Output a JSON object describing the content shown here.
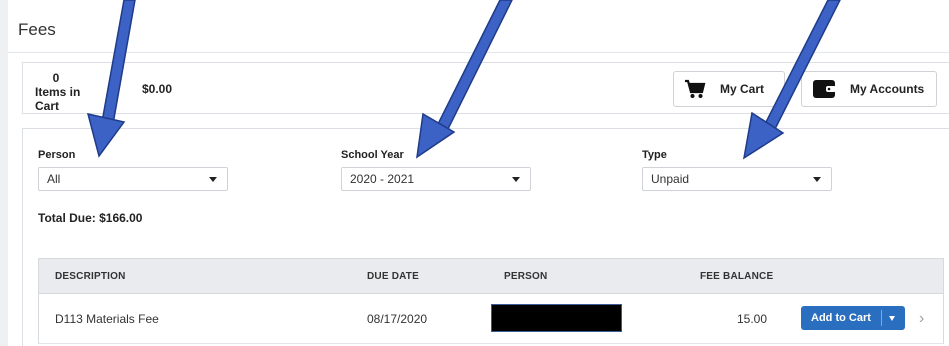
{
  "page": {
    "title": "Fees"
  },
  "cart": {
    "count": "0",
    "count_label": "Items in Cart",
    "total": "$0.00",
    "my_cart_label": "My Cart",
    "my_accounts_label": "My Accounts"
  },
  "filters": {
    "person": {
      "label": "Person",
      "value": "All"
    },
    "school_year": {
      "label": "School Year",
      "value": "2020 - 2021"
    },
    "type": {
      "label": "Type",
      "value": "Unpaid"
    }
  },
  "total_due": "Total Due: $166.00",
  "table": {
    "headers": [
      "DESCRIPTION",
      "DUE DATE",
      "PERSON",
      "FEE BALANCE"
    ],
    "rows": [
      {
        "description": "D113 Materials Fee",
        "due_date": "08/17/2020",
        "person": "",
        "balance": "15.00",
        "action": "Add to Cart"
      }
    ]
  },
  "colors": {
    "accent": "#2a6fbf",
    "arrow": "#3b62c4",
    "header_bg": "#e9ebee"
  }
}
